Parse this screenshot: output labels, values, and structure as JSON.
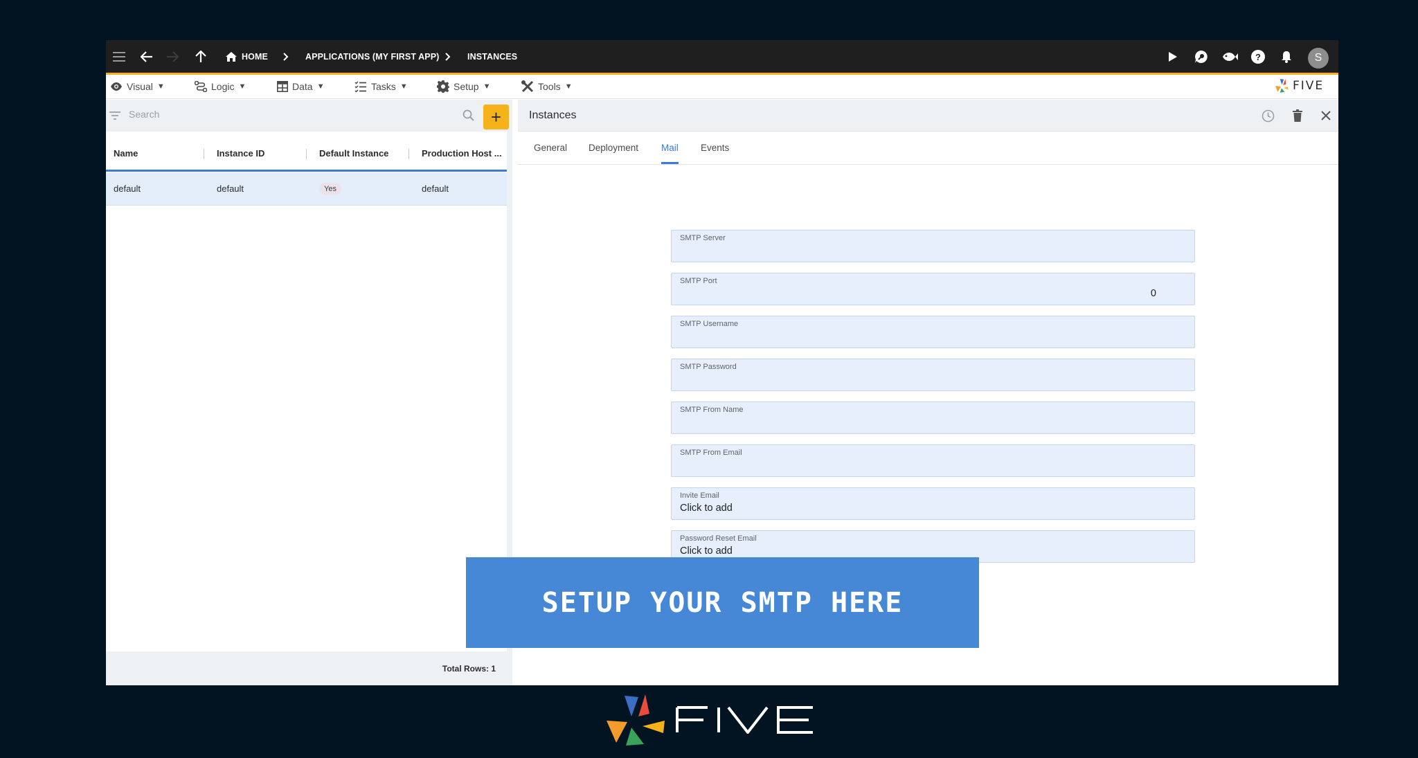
{
  "topbar": {
    "breadcrumbs": [
      "HOME",
      "APPLICATIONS (MY FIRST APP)",
      "INSTANCES"
    ],
    "avatar_initial": "S"
  },
  "menu": {
    "items": [
      "Visual",
      "Logic",
      "Data",
      "Tasks",
      "Setup",
      "Tools"
    ],
    "caret": "▼",
    "brand": "FIVE"
  },
  "list": {
    "search_placeholder": "Search",
    "add_label": "+",
    "columns": [
      "Name",
      "Instance ID",
      "Default Instance",
      "Production Host ..."
    ],
    "rows": [
      {
        "name": "default",
        "instance_id": "default",
        "default_instance": "Yes",
        "production_host": "default"
      }
    ],
    "total_rows": "Total Rows: 1"
  },
  "detail": {
    "title": "Instances",
    "tabs": [
      "General",
      "Deployment",
      "Mail",
      "Events"
    ],
    "active_tab": "Mail",
    "fields": [
      {
        "label": "SMTP Server",
        "value": ""
      },
      {
        "label": "SMTP Port",
        "value": "0"
      },
      {
        "label": "SMTP Username",
        "value": ""
      },
      {
        "label": "SMTP Password",
        "value": ""
      },
      {
        "label": "SMTP From Name",
        "value": ""
      },
      {
        "label": "SMTP From Email",
        "value": ""
      },
      {
        "label": "Invite Email",
        "value": "Click to add"
      },
      {
        "label": "Password Reset Email",
        "value": "Click to add"
      }
    ]
  },
  "banner": {
    "text": "SETUP YOUR SMTP HERE"
  },
  "logo": {
    "text": "FIVE"
  },
  "colors": {
    "accent": "#f5b21a",
    "primary": "#3b7bd8",
    "field_bg": "#e6effb",
    "banner": "#4788d6",
    "background": "#021321"
  }
}
